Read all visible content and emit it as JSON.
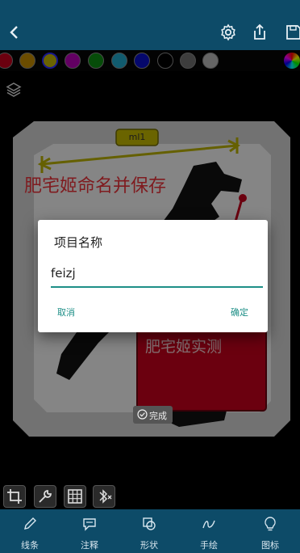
{
  "colors": {
    "swatches": [
      "#c4001d",
      "#c38a00",
      "#c3b400",
      "#b400b5",
      "#0b8a12",
      "#1fa6c8",
      "#0a0fc5",
      "#000000",
      "#6f6f6f",
      "#b8b8b8"
    ]
  },
  "canvas": {
    "annotation_title": "肥宅姬命名并保存",
    "dimension_label": "ml1",
    "red_box_text": "肥宅姬实测",
    "done_label": "完成"
  },
  "dialog": {
    "title": "项目名称",
    "value": "feizj",
    "cancel": "取消",
    "confirm": "确定"
  },
  "bottom_nav": [
    {
      "label": "线条",
      "icon": "pencil-icon"
    },
    {
      "label": "注释",
      "icon": "comment-icon"
    },
    {
      "label": "形状",
      "icon": "shapes-icon"
    },
    {
      "label": "手绘",
      "icon": "freehand-icon"
    },
    {
      "label": "图标",
      "icon": "lightbulb-icon"
    }
  ]
}
